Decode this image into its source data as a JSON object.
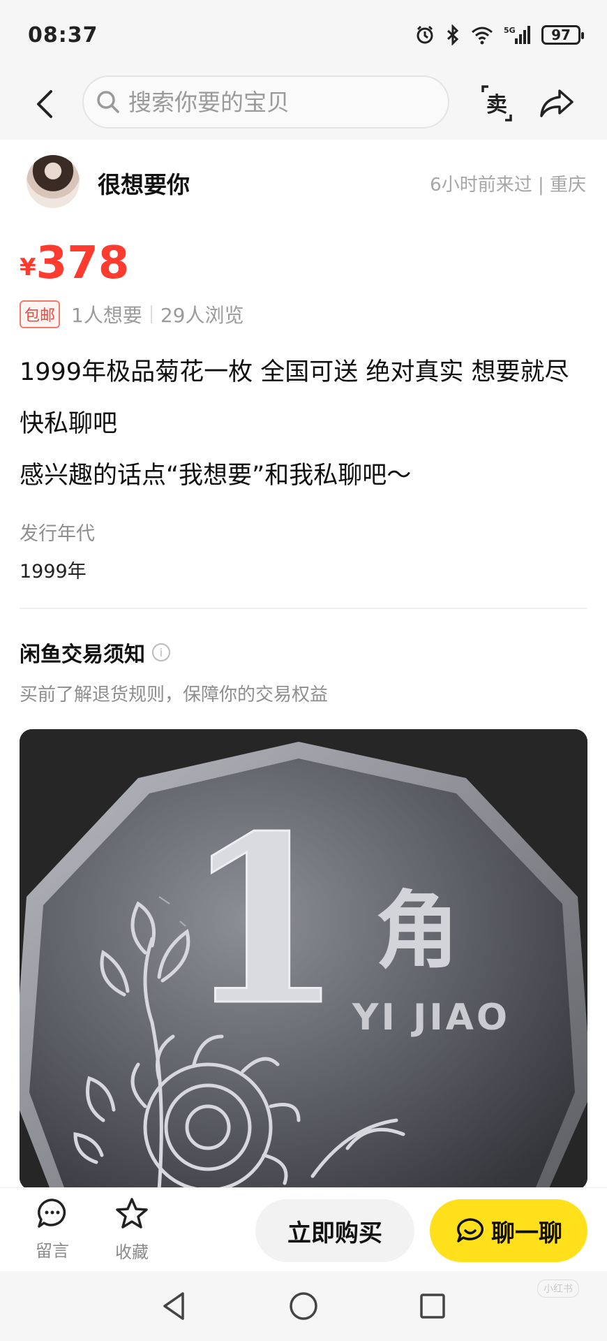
{
  "status_bar": {
    "time": "08:37",
    "network": "5G",
    "battery": "97"
  },
  "nav": {
    "search_placeholder": "搜索你要的宝贝",
    "sell_label": "卖"
  },
  "seller": {
    "name": "很想要你",
    "meta": "6小时前来过 | 重庆"
  },
  "product": {
    "currency": "¥",
    "price": "378",
    "shipping_badge": "包邮",
    "wants": "1人想要",
    "views": "29人浏览",
    "title": "1999年极品菊花一枚 全国可送 绝对真实 想要就尽快私聊吧",
    "description": "感兴趣的话点“我想要”和我私聊吧～",
    "attr_label": "发行年代",
    "attr_value": "1999年",
    "image_text": {
      "denomination": "1",
      "unit": "角",
      "pinyin": "YI JIAO"
    }
  },
  "notice": {
    "title": "闲鱼交易须知",
    "subtitle": "买前了解退货规则，保障你的交易权益"
  },
  "bottom_bar": {
    "comment_label": "留言",
    "favorite_label": "收藏",
    "buy_label": "立即购买",
    "chat_label": "聊一聊"
  },
  "watermark": "小红书",
  "colors": {
    "price": "#ff3b2f",
    "chat_button": "#ffe01b",
    "buy_button": "#f2f2f2"
  },
  "icons": [
    "back-icon",
    "search-icon",
    "sell-icon",
    "share-icon",
    "comment-icon",
    "star-icon",
    "chat-bubble-icon",
    "nav-back-icon",
    "nav-home-icon",
    "nav-recents-icon"
  ]
}
